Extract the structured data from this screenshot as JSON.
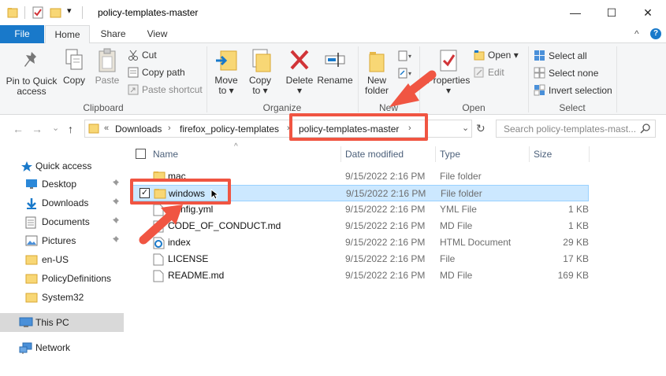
{
  "window": {
    "title": "policy-templates-master",
    "minimize": "—",
    "maximize": "☐",
    "close": "✕",
    "quick_access_dropdown": "▾"
  },
  "tabs": {
    "file": "File",
    "home": "Home",
    "share": "Share",
    "view": "View"
  },
  "ribbon": {
    "clipboard": {
      "pin_line1": "Pin to Quick",
      "pin_line2": "access",
      "copy": "Copy",
      "paste": "Paste",
      "cut": "Cut",
      "copy_path": "Copy path",
      "paste_shortcut": "Paste shortcut",
      "group": "Clipboard"
    },
    "organize": {
      "move_to_line1": "Move",
      "move_to_line2": "to ▾",
      "copy_to_line1": "Copy",
      "copy_to_line2": "to ▾",
      "delete_line1": "Delete",
      "delete_line2": "▾",
      "rename": "Rename",
      "group": "Organize"
    },
    "new": {
      "new_folder_line1": "New",
      "new_folder_line2": "folder",
      "group": "New"
    },
    "open": {
      "properties_line1": "Properties",
      "properties_line2": "▾",
      "open": "Open ▾",
      "edit": "Edit",
      "group": "Open"
    },
    "select": {
      "select_all": "Select all",
      "select_none": "Select none",
      "invert_selection": "Invert selection",
      "group": "Select"
    },
    "collapse": "^",
    "help": "?"
  },
  "address": {
    "overflow": "«",
    "crumbs": [
      "Downloads",
      "firefox_policy-templates",
      "policy-templates-master"
    ],
    "separator": "›",
    "dropdown": "⌄",
    "refresh": "↻",
    "search_placeholder": "Search policy-templates-mast..."
  },
  "nav": {
    "back": "←",
    "forward": "→",
    "recent": "⌄",
    "up": "↑",
    "items": [
      {
        "label": "Quick access"
      },
      {
        "label": "Desktop",
        "pinned": true
      },
      {
        "label": "Downloads",
        "pinned": true
      },
      {
        "label": "Documents",
        "pinned": true
      },
      {
        "label": "Pictures",
        "pinned": true
      },
      {
        "label": "en-US"
      },
      {
        "label": "PolicyDefinitions"
      },
      {
        "label": "System32"
      },
      {
        "label": "This PC"
      },
      {
        "label": "Network"
      }
    ],
    "pin_glyph": "📌"
  },
  "columns": {
    "name": "Name",
    "date": "Date modified",
    "type": "Type",
    "size": "Size",
    "sort_indicator": "^"
  },
  "files": [
    {
      "name": "mac",
      "date": "9/15/2022 2:16 PM",
      "type": "File folder",
      "size": "",
      "icon": "folder-icon"
    },
    {
      "name": "windows",
      "date": "9/15/2022 2:16 PM",
      "type": "File folder",
      "size": "",
      "icon": "folder-icon",
      "selected": true
    },
    {
      "name": ".config.yml",
      "date": "9/15/2022 2:16 PM",
      "type": "YML File",
      "size": "1 KB",
      "icon": "file-icon"
    },
    {
      "name": "CODE_OF_CONDUCT.md",
      "date": "9/15/2022 2:16 PM",
      "type": "MD File",
      "size": "1 KB",
      "icon": "file-icon"
    },
    {
      "name": "index",
      "date": "9/15/2022 2:16 PM",
      "type": "HTML Document",
      "size": "29 KB",
      "icon": "edge-html-icon"
    },
    {
      "name": "LICENSE",
      "date": "9/15/2022 2:16 PM",
      "type": "File",
      "size": "17 KB",
      "icon": "file-icon"
    },
    {
      "name": "README.md",
      "date": "9/15/2022 2:16 PM",
      "type": "MD File",
      "size": "169 KB",
      "icon": "file-icon"
    }
  ],
  "colors": {
    "accent": "#1979ca",
    "annotation": "#f05542",
    "selection": "#cce8ff",
    "folder": "#f8d775"
  }
}
